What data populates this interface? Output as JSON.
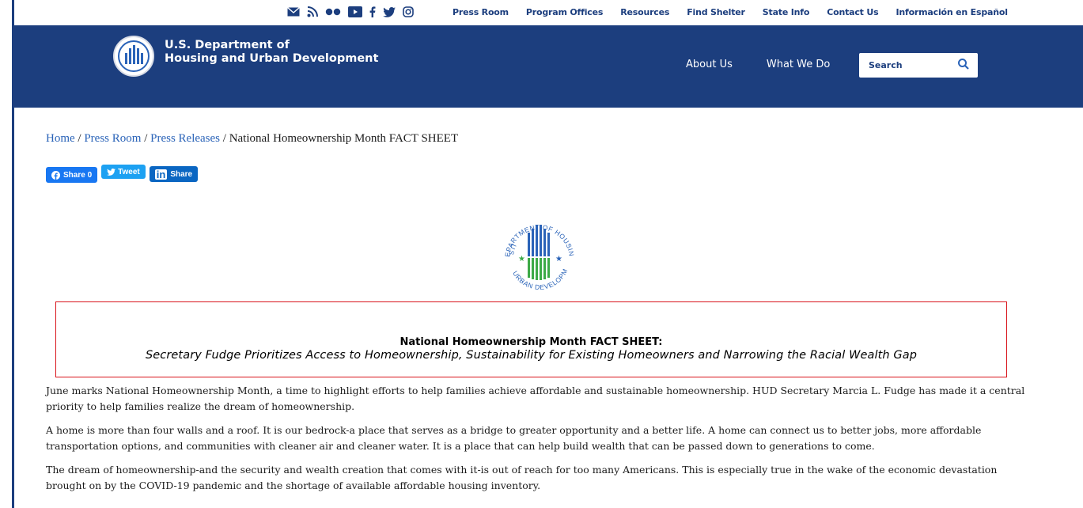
{
  "social": {
    "icons": [
      "email-icon",
      "rss-icon",
      "flickr-icon",
      "youtube-icon",
      "facebook-icon",
      "twitter-icon",
      "instagram-icon"
    ],
    "glyphs": [
      "✉",
      "≋",
      "●●",
      "▶",
      "f",
      "🐦",
      "◎"
    ]
  },
  "util_links": [
    "Press Room",
    "Program Offices",
    "Resources",
    "Find Shelter",
    "State Info",
    "Contact Us",
    "Información en Español"
  ],
  "header": {
    "agency_line1": "U.S. Department of",
    "agency_line2": "Housing and Urban Development",
    "nav": [
      "About Us",
      "What We Do"
    ],
    "search_placeholder": "Search"
  },
  "breadcrumb": {
    "home": "Home",
    "sep": " / ",
    "press_room": "Press Room",
    "press_releases": "Press Releases",
    "current": "National Homeownership Month FACT SHEET"
  },
  "share": {
    "facebook": "Share 0",
    "twitter": "Tweet",
    "linkedin_brand": "in",
    "linkedin": "Share"
  },
  "seal": {
    "text_top": "DEPARTMENT OF HOUSING",
    "text_left": "U.S.",
    "text_bottom": "AND URBAN DEVELOPMENT"
  },
  "fact_sheet": {
    "title": "National Homeownership Month FACT SHEET:",
    "subtitle": "Secretary Fudge Prioritizes Access to Homeownership, Sustainability for Existing Homeowners and Narrowing the Racial Wealth Gap"
  },
  "paragraphs": [
    "June marks National Homeownership Month, a time to highlight efforts to help families achieve affordable and sustainable homeownership. HUD Secretary Marcia L. Fudge has made it a central priority to help families realize the dream of homeownership.",
    "A home is more than four walls and a roof. It is our bedrock-a place that serves as a bridge to greater opportunity and a better life. A home can connect us to better jobs, more affordable transportation options, and communities with cleaner air and cleaner water. It is a place that can help build wealth that can be passed down to generations to come.",
    "The dream of homeownership-and the security and wealth creation that comes with it-is out of reach for too many Americans. This is especially true in the wake of the economic devastation brought on by the COVID-19 pandemic and the shortage of available affordable housing inventory."
  ],
  "colors": {
    "brand_blue": "#1c3e7e",
    "link_blue": "#2a63b8",
    "box_red": "#d9141b"
  }
}
